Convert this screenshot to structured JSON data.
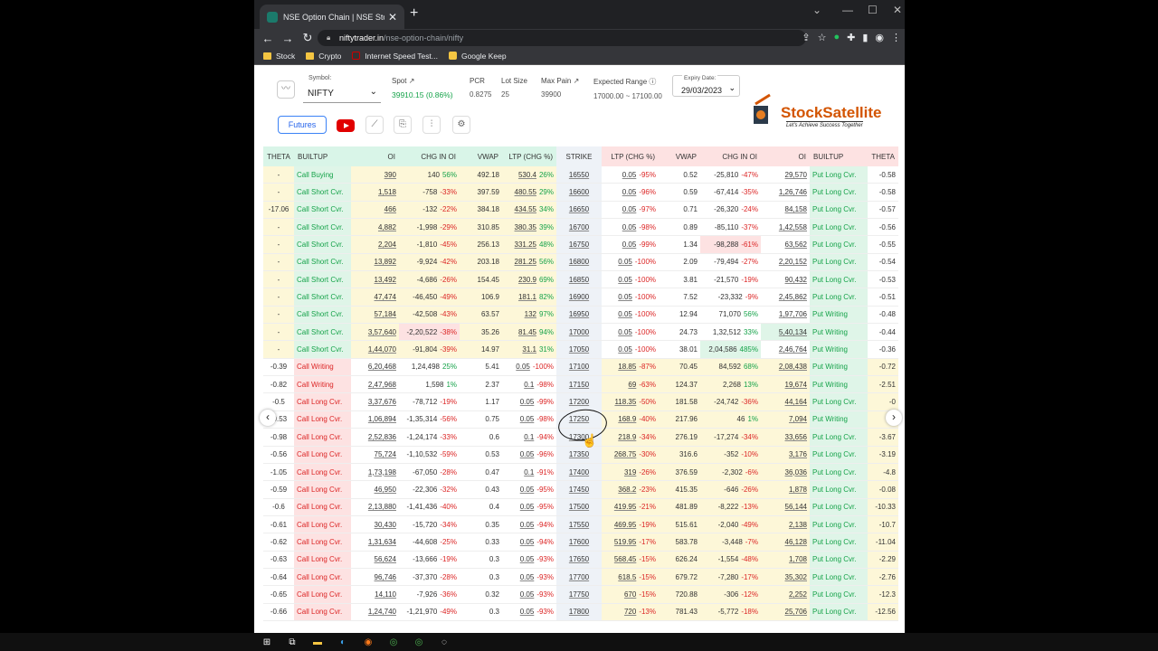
{
  "browser": {
    "tab_title": "NSE Option Chain | NSE Stocks O",
    "url_host": "niftytrader.in",
    "url_path": "/nse-option-chain/nifty",
    "bookmarks": [
      "Stock",
      "Crypto",
      "Internet Speed Test...",
      "Google Keep"
    ]
  },
  "controls": {
    "symbol_label": "Symbol:",
    "symbol_value": "NIFTY",
    "spot_label": "Spot",
    "spot_value": "39910.15 (0.86%)",
    "pcr_label": "PCR",
    "pcr_value": "0.8275",
    "lot_label": "Lot Size",
    "lot_value": "25",
    "maxpain_label": "Max Pain",
    "maxpain_value": "39900",
    "exprange_label": "Expected Range",
    "exprange_value": "17000.00 ~ 17100.00",
    "expiry_label": "Expiry Date:",
    "expiry_value": "29/03/2023",
    "futures_label": "Futures"
  },
  "logo": {
    "name": "StockSatellite",
    "tagline": "Let's Achieve Success Together"
  },
  "table": {
    "headers": [
      "THETA",
      "BUILTUP",
      "OI",
      "CHG IN OI",
      "VWAP",
      "LTP (CHG %)",
      "STRIKE",
      "LTP (CHG %)",
      "VWAP",
      "CHG IN OI",
      "OI",
      "BUILTUP",
      "THETA"
    ],
    "rows": [
      [
        "-",
        "Call Buying",
        "390",
        "140",
        "56%",
        "492.18",
        "530.4",
        "26%",
        "16550",
        "0.05",
        "-95%",
        "0.52",
        "-25,810",
        "-47%",
        "29,570",
        "Put Long Cvr.",
        "-0.58"
      ],
      [
        "-",
        "Call Short Cvr.",
        "1,518",
        "-758",
        "-33%",
        "397.59",
        "480.55",
        "29%",
        "16600",
        "0.05",
        "-96%",
        "0.59",
        "-67,414",
        "-35%",
        "1,26,746",
        "Put Long Cvr.",
        "-0.58"
      ],
      [
        "-17.06",
        "Call Short Cvr.",
        "466",
        "-132",
        "-22%",
        "384.18",
        "434.55",
        "34%",
        "16650",
        "0.05",
        "-97%",
        "0.71",
        "-26,320",
        "-24%",
        "84,158",
        "Put Long Cvr.",
        "-0.57"
      ],
      [
        "-",
        "Call Short Cvr.",
        "4,882",
        "-1,998",
        "-29%",
        "310.85",
        "380.35",
        "39%",
        "16700",
        "0.05",
        "-98%",
        "0.89",
        "-85,110",
        "-37%",
        "1,42,558",
        "Put Long Cvr.",
        "-0.56"
      ],
      [
        "-",
        "Call Short Cvr.",
        "2,204",
        "-1,810",
        "-45%",
        "256.13",
        "331.25",
        "48%",
        "16750",
        "0.05",
        "-99%",
        "1.34",
        "-98,288",
        "-61%",
        "63,562",
        "Put Long Cvr.",
        "-0.55"
      ],
      [
        "-",
        "Call Short Cvr.",
        "13,892",
        "-9,924",
        "-42%",
        "203.18",
        "281.25",
        "56%",
        "16800",
        "0.05",
        "-100%",
        "2.09",
        "-79,494",
        "-27%",
        "2,20,152",
        "Put Long Cvr.",
        "-0.54"
      ],
      [
        "-",
        "Call Short Cvr.",
        "13,492",
        "-4,686",
        "-26%",
        "154.45",
        "230.9",
        "69%",
        "16850",
        "0.05",
        "-100%",
        "3.81",
        "-21,570",
        "-19%",
        "90,432",
        "Put Long Cvr.",
        "-0.53"
      ],
      [
        "-",
        "Call Short Cvr.",
        "47,474",
        "-46,450",
        "-49%",
        "106.9",
        "181.1",
        "82%",
        "16900",
        "0.05",
        "-100%",
        "7.52",
        "-23,332",
        "-9%",
        "2,45,862",
        "Put Long Cvr.",
        "-0.51"
      ],
      [
        "-",
        "Call Short Cvr.",
        "57,184",
        "-42,508",
        "-43%",
        "63.57",
        "132",
        "97%",
        "16950",
        "0.05",
        "-100%",
        "12.94",
        "71,070",
        "56%",
        "1,97,706",
        "Put Writing",
        "-0.48"
      ],
      [
        "-",
        "Call Short Cvr.",
        "3,57,640",
        "-2,20,522",
        "-38%",
        "35.26",
        "81.45",
        "94%",
        "17000",
        "0.05",
        "-100%",
        "24.73",
        "1,32,512",
        "33%",
        "5,40,134",
        "Put Writing",
        "-0.44"
      ],
      [
        "-",
        "Call Short Cvr.",
        "1,44,070",
        "-91,804",
        "-39%",
        "14.97",
        "31.1",
        "31%",
        "17050",
        "0.05",
        "-100%",
        "38.01",
        "2,04,586",
        "485%",
        "2,46,764",
        "Put Writing",
        "-0.36"
      ],
      [
        "-0.39",
        "Call Writing",
        "6,20,468",
        "1,24,498",
        "25%",
        "5.41",
        "0.05",
        "-100%",
        "17100",
        "18.85",
        "-87%",
        "70.45",
        "84,592",
        "68%",
        "2,08,438",
        "Put Writing",
        "-0.72"
      ],
      [
        "-0.82",
        "Call Writing",
        "2,47,968",
        "1,598",
        "1%",
        "2.37",
        "0.1",
        "-98%",
        "17150",
        "69",
        "-63%",
        "124.37",
        "2,268",
        "13%",
        "19,674",
        "Put Writing",
        "-2.51"
      ],
      [
        "-0.5",
        "Call Long Cvr.",
        "3,37,676",
        "-78,712",
        "-19%",
        "1.17",
        "0.05",
        "-99%",
        "17200",
        "118.35",
        "-50%",
        "181.58",
        "-24,742",
        "-36%",
        "44,164",
        "Put Long Cvr.",
        "-0"
      ],
      [
        "-0.53",
        "Call Long Cvr.",
        "1,06,894",
        "-1,35,314",
        "-56%",
        "0.75",
        "0.05",
        "-98%",
        "17250",
        "168.9",
        "-40%",
        "217.96",
        "46",
        "1%",
        "7,094",
        "Put Writing",
        "-0"
      ],
      [
        "-0.98",
        "Call Long Cvr.",
        "2,52,836",
        "-1,24,174",
        "-33%",
        "0.6",
        "0.1",
        "-94%",
        "17300",
        "218.9",
        "-34%",
        "276.19",
        "-17,274",
        "-34%",
        "33,656",
        "Put Long Cvr.",
        "-3.67"
      ],
      [
        "-0.56",
        "Call Long Cvr.",
        "75,724",
        "-1,10,532",
        "-59%",
        "0.53",
        "0.05",
        "-96%",
        "17350",
        "268.75",
        "-30%",
        "316.6",
        "-352",
        "-10%",
        "3,176",
        "Put Long Cvr.",
        "-3.19"
      ],
      [
        "-1.05",
        "Call Long Cvr.",
        "1,73,198",
        "-67,050",
        "-28%",
        "0.47",
        "0.1",
        "-91%",
        "17400",
        "319",
        "-26%",
        "376.59",
        "-2,302",
        "-6%",
        "36,036",
        "Put Long Cvr.",
        "-4.8"
      ],
      [
        "-0.59",
        "Call Long Cvr.",
        "46,950",
        "-22,306",
        "-32%",
        "0.43",
        "0.05",
        "-95%",
        "17450",
        "368.2",
        "-23%",
        "415.35",
        "-646",
        "-26%",
        "1,878",
        "Put Long Cvr.",
        "-0.08"
      ],
      [
        "-0.6",
        "Call Long Cvr.",
        "2,13,880",
        "-1,41,436",
        "-40%",
        "0.4",
        "0.05",
        "-95%",
        "17500",
        "419.95",
        "-21%",
        "481.89",
        "-8,222",
        "-13%",
        "56,144",
        "Put Long Cvr.",
        "-10.33"
      ],
      [
        "-0.61",
        "Call Long Cvr.",
        "30,430",
        "-15,720",
        "-34%",
        "0.35",
        "0.05",
        "-94%",
        "17550",
        "469.95",
        "-19%",
        "515.61",
        "-2,040",
        "-49%",
        "2,138",
        "Put Long Cvr.",
        "-10.7"
      ],
      [
        "-0.62",
        "Call Long Cvr.",
        "1,31,634",
        "-44,608",
        "-25%",
        "0.33",
        "0.05",
        "-94%",
        "17600",
        "519.95",
        "-17%",
        "583.78",
        "-3,448",
        "-7%",
        "46,128",
        "Put Long Cvr.",
        "-11.04"
      ],
      [
        "-0.63",
        "Call Long Cvr.",
        "56,624",
        "-13,666",
        "-19%",
        "0.3",
        "0.05",
        "-93%",
        "17650",
        "568.45",
        "-15%",
        "626.24",
        "-1,554",
        "-48%",
        "1,708",
        "Put Long Cvr.",
        "-2.29"
      ],
      [
        "-0.64",
        "Call Long Cvr.",
        "96,746",
        "-37,370",
        "-28%",
        "0.3",
        "0.05",
        "-93%",
        "17700",
        "618.5",
        "-15%",
        "679.72",
        "-7,280",
        "-17%",
        "35,302",
        "Put Long Cvr.",
        "-2.76"
      ],
      [
        "-0.65",
        "Call Long Cvr.",
        "14,110",
        "-7,926",
        "-36%",
        "0.32",
        "0.05",
        "-93%",
        "17750",
        "670",
        "-15%",
        "720.88",
        "-306",
        "-12%",
        "2,252",
        "Put Long Cvr.",
        "-12.3"
      ],
      [
        "-0.66",
        "Call Long Cvr.",
        "1,24,740",
        "-1,21,970",
        "-49%",
        "0.3",
        "0.05",
        "-93%",
        "17800",
        "720",
        "-13%",
        "781.43",
        "-5,772",
        "-18%",
        "25,706",
        "Put Long Cvr.",
        "-12.56"
      ]
    ]
  },
  "colors": {
    "call_itm_bg": "#fdf7d8",
    "put_itm_bg": "#fdf7d8",
    "builtup_green_bg": "#dff5e8",
    "builtup_red_bg": "#fde2e2",
    "header_call_bg": "#d9f5e8",
    "header_put_bg": "#fde2e2",
    "strike_bg": "#eef2f7"
  }
}
